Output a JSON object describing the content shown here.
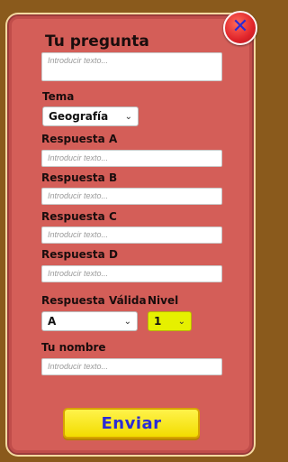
{
  "title": "Tu pregunta",
  "question_placeholder": "Introducir texto...",
  "tema": {
    "label": "Tema",
    "selected": "Geografía"
  },
  "answers": [
    {
      "label": "Respuesta A",
      "placeholder": "Introducir texto..."
    },
    {
      "label": "Respuesta B",
      "placeholder": "Introducir texto..."
    },
    {
      "label": "Respuesta C",
      "placeholder": "Introducir texto..."
    },
    {
      "label": "Respuesta D",
      "placeholder": "Introducir texto..."
    }
  ],
  "valid_answer": {
    "label": "Respuesta Válida",
    "selected": "A"
  },
  "level": {
    "label": "Nivel",
    "selected": "1"
  },
  "name": {
    "label": "Tu nombre",
    "placeholder": "Introducir texto..."
  },
  "submit_label": "Enviar",
  "close_icon": "close-icon",
  "colors": {
    "panel": "#d45e58",
    "submit": "#f2dc00",
    "level_select": "#e6f000",
    "close": "#e0242a"
  }
}
